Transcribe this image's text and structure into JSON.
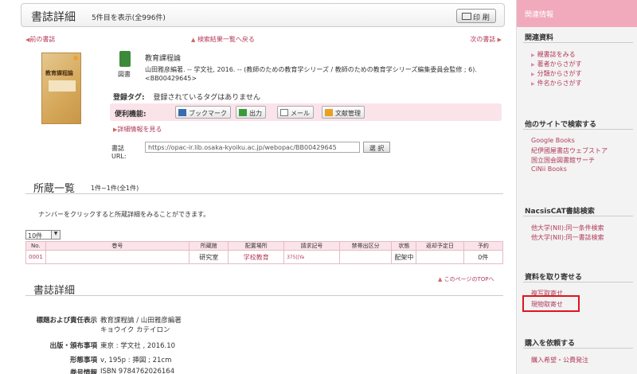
{
  "header": {
    "title": "書誌詳細",
    "count": "5件目を表示(全996件)",
    "print": "印 刷"
  },
  "nav": {
    "prev": "前の書誌",
    "back": "検索結果一覧へ戻る",
    "next": "次の書誌"
  },
  "book": {
    "cover_title": "教育課程論",
    "type_label": "図書",
    "title": "教育課程論",
    "responsibility": "山田雅彦編著. -- 学文社, 2016. -- (教師のための教育学シリーズ / 教師のための教育学シリーズ編集委員会監修 ; 6).<BB00429645>"
  },
  "tags": {
    "label": "登録タグ:",
    "value": "登録されているタグはありません"
  },
  "functions": {
    "label": "便利機能:",
    "bookmark": "ブックマーク",
    "output": "出力",
    "mail": "メール",
    "doc": "文献管理"
  },
  "detail_link": "詳細情報を見る",
  "url": {
    "label": "書誌URL:",
    "value": "https://opac-ir.lib.osaka-kyoiku.ac.jp/webopac/BB00429645",
    "select": "選 択"
  },
  "holdings": {
    "title": "所蔵一覧",
    "sub": "1件~1件(全1件)",
    "instruction": "ナンバーをクリックすると所蔵詳細をみることができます。",
    "per_page": "10件",
    "columns": [
      "No.",
      "巻号",
      "所蔵館",
      "配置場所",
      "請求記号",
      "禁帯出区分",
      "状態",
      "返却予定日",
      "予約"
    ],
    "rows": [
      [
        "0001",
        "",
        "研究室",
        "学校教育",
        "375||Ya",
        "",
        "配架中",
        "",
        "0件"
      ]
    ]
  },
  "top_link": "このページのTOPへ",
  "bib": {
    "title": "書誌詳細",
    "rows": [
      {
        "k": "標題および責任表示",
        "v": "教育課程論 / 山田雅彦編著"
      },
      {
        "k": "",
        "v": "キョウイク カテイロン"
      },
      {
        "k": "出版・頒布事項",
        "v": "東京 : 学文社 , 2016.10"
      },
      {
        "k": "形態事項",
        "v": "v, 195p : 挿図 ; 21cm"
      },
      {
        "k": "巻号情報",
        "v": "ISBN 9784762026164"
      }
    ]
  },
  "sidebar": {
    "head": "関連情報",
    "related_title": "関連資料",
    "related": [
      "親書誌をみる",
      "著者からさがす",
      "分類からさがす",
      "件名からさがす"
    ],
    "other_title": "他のサイトで検索する",
    "other": [
      "Google Books",
      "紀伊國屋書店ウェブストア",
      "国立国会図書館サーチ",
      "CiNii Books"
    ],
    "nacsis_title": "NacsisCAT書誌検索",
    "nacsis": [
      "他大学(NII):同一条件検索",
      "他大学(NII):同一書誌検索"
    ],
    "order_title": "資料を取り寄せる",
    "order": [
      "複写取寄せ",
      "現物取寄せ"
    ],
    "request_title": "購入を依頼する",
    "request": [
      "購入希望・公費発注"
    ]
  },
  "colors": {
    "accent": "#b23b5b",
    "pink_bg": "#fbe3ea",
    "side_head": "#f0aabb",
    "highlight": "#e0141e"
  }
}
